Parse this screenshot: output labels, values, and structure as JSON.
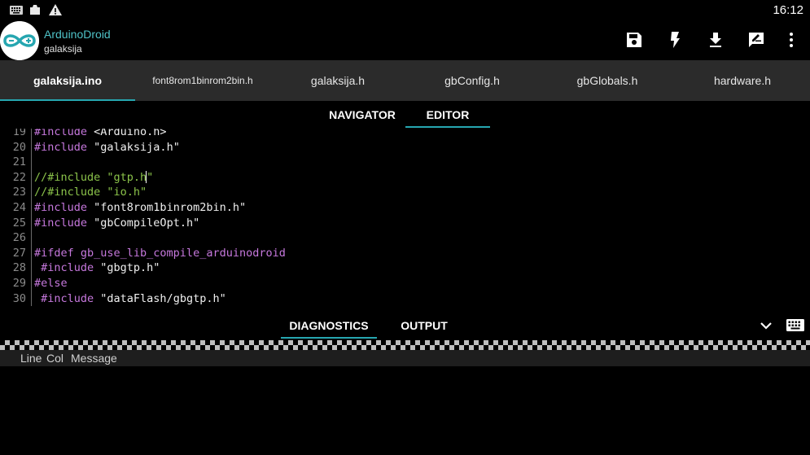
{
  "status_bar": {
    "time": "16:12",
    "icons": [
      "keyboard-icon",
      "photo-icon",
      "warning-icon"
    ]
  },
  "app_bar": {
    "title": "ArduinoDroid",
    "subtitle": "galaksija",
    "actions": [
      "save-icon",
      "flash-icon",
      "download-icon",
      "comment-edit-icon",
      "more-vert-icon"
    ]
  },
  "file_tabs": [
    {
      "label": "galaksija.ino",
      "active": true
    },
    {
      "label": "font8rom1binrom2bin.h",
      "active": false
    },
    {
      "label": "galaksija.h",
      "active": false
    },
    {
      "label": "gbConfig.h",
      "active": false
    },
    {
      "label": "gbGlobals.h",
      "active": false
    },
    {
      "label": "hardware.h",
      "active": false
    }
  ],
  "view_tabs": [
    {
      "label": "NAVIGATOR",
      "active": false
    },
    {
      "label": "EDITOR",
      "active": true
    }
  ],
  "editor": {
    "lines": [
      {
        "n": "19",
        "parts": [
          {
            "t": "kw",
            "s": "#include"
          },
          {
            "t": "str",
            "s": " <Arduino.h>"
          }
        ]
      },
      {
        "n": "20",
        "parts": [
          {
            "t": "kw",
            "s": "#include"
          },
          {
            "t": "str",
            "s": " \"galaksija.h\""
          }
        ]
      },
      {
        "n": "21",
        "parts": []
      },
      {
        "n": "22",
        "parts": [
          {
            "t": "cmt",
            "s": "//#include \"gtp.h"
          },
          {
            "t": "cursor",
            "s": ""
          },
          {
            "t": "cmt",
            "s": "\""
          }
        ]
      },
      {
        "n": "23",
        "parts": [
          {
            "t": "cmt",
            "s": "//#include \"io.h\""
          }
        ]
      },
      {
        "n": "24",
        "parts": [
          {
            "t": "kw",
            "s": "#include"
          },
          {
            "t": "str",
            "s": " \"font8rom1binrom2bin.h\""
          }
        ]
      },
      {
        "n": "25",
        "parts": [
          {
            "t": "kw",
            "s": "#include"
          },
          {
            "t": "str",
            "s": " \"gbCompileOpt.h\""
          }
        ]
      },
      {
        "n": "26",
        "parts": []
      },
      {
        "n": "27",
        "parts": [
          {
            "t": "kw",
            "s": "#ifdef gb_use_lib_compile_arduinodroid"
          }
        ]
      },
      {
        "n": "28",
        "parts": [
          {
            "t": "kw",
            "s": " #include"
          },
          {
            "t": "str",
            "s": " \"gbgtp.h\""
          }
        ]
      },
      {
        "n": "29",
        "parts": [
          {
            "t": "kw",
            "s": "#else"
          }
        ]
      },
      {
        "n": "30",
        "parts": [
          {
            "t": "kw",
            "s": " #include"
          },
          {
            "t": "str",
            "s": " \"dataFlash/gbgtp.h\""
          }
        ]
      }
    ]
  },
  "bottom_tabs": [
    {
      "label": "DIAGNOSTICS",
      "active": true
    },
    {
      "label": "OUTPUT",
      "active": false
    }
  ],
  "bottom_actions": [
    "chevron-down-icon",
    "keyboard-icon"
  ],
  "diagnostics": {
    "columns": [
      "Line",
      "Col",
      "Message"
    ]
  }
}
